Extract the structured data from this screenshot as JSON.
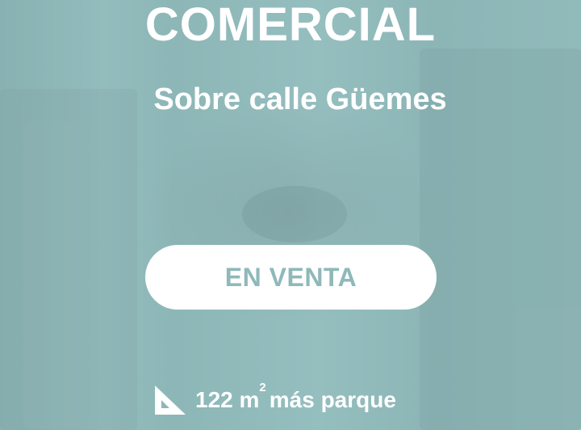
{
  "header": {
    "title": "COMERCIAL",
    "subtitle": "Sobre calle Güemes"
  },
  "cta": {
    "label": "EN VENTA"
  },
  "area": {
    "icon": "set-square-icon",
    "value": "122 m",
    "superscript": "2",
    "suffix": "más parque"
  },
  "colors": {
    "background": "#8fb8b9",
    "text": "#ffffff",
    "button_text": "#8fb8b9"
  }
}
